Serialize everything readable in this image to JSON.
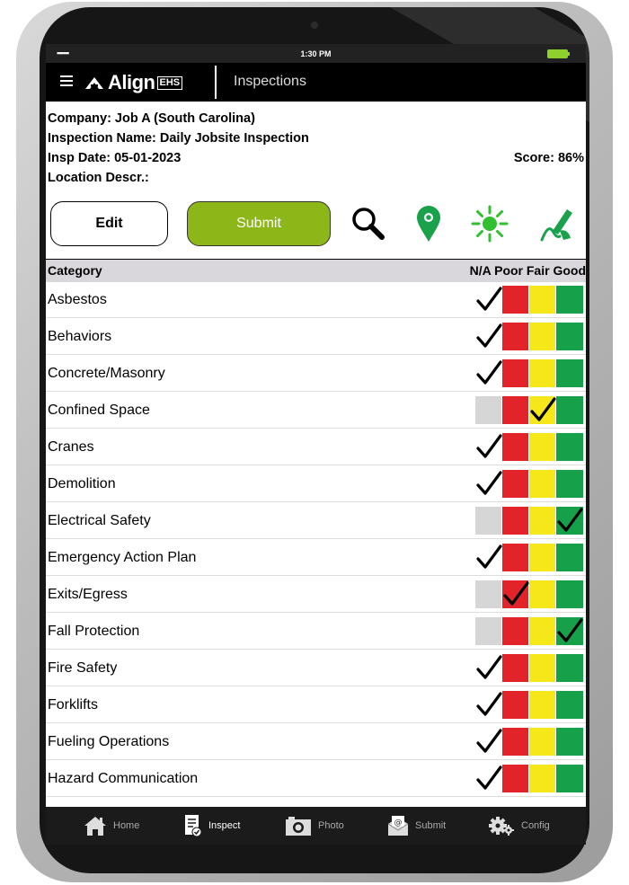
{
  "status_bar": {
    "signal": "▪▪▪▪▪▪",
    "time": "1:30 PM"
  },
  "app": {
    "brand": "Align",
    "brand_badge": "EHS",
    "section": "Inspections"
  },
  "info": {
    "company": "Company: Job A (South Carolina)",
    "inspection_name": "Inspection Name: Daily Jobsite Inspection",
    "insp_date": "Insp Date: 05-01-2023",
    "score": "Score: 86%",
    "location": "Location Descr.:"
  },
  "buttons": {
    "edit": "Edit",
    "submit": "Submit"
  },
  "toolbar_icons": [
    "search-icon",
    "map-pin-icon",
    "sun-icon",
    "signature-icon"
  ],
  "table": {
    "header_category": "Category",
    "header_cols": "N/A Poor Fair Good",
    "rows": [
      {
        "label": "Asbestos",
        "rating": "na"
      },
      {
        "label": "Behaviors",
        "rating": "na"
      },
      {
        "label": "Concrete/Masonry",
        "rating": "na"
      },
      {
        "label": "Confined Space",
        "rating": "fair"
      },
      {
        "label": "Cranes",
        "rating": "na"
      },
      {
        "label": "Demolition",
        "rating": "na"
      },
      {
        "label": "Electrical Safety",
        "rating": "good"
      },
      {
        "label": "Emergency Action Plan",
        "rating": "na"
      },
      {
        "label": "Exits/Egress",
        "rating": "poor"
      },
      {
        "label": "Fall Protection",
        "rating": "good"
      },
      {
        "label": "Fire Safety",
        "rating": "na"
      },
      {
        "label": "Forklifts",
        "rating": "na"
      },
      {
        "label": "Fueling Operations",
        "rating": "na"
      },
      {
        "label": "Hazard Communication",
        "rating": "na"
      }
    ]
  },
  "tabbar": {
    "home": "Home",
    "inspect": "Inspect",
    "photo": "Photo",
    "submit": "Submit",
    "config": "Config",
    "active": "inspect"
  },
  "colors": {
    "submit_green": "#8db719",
    "poor": "#e2242a",
    "fair": "#f5e71a",
    "good": "#17a04a",
    "pin_green": "#1aa14b",
    "sun_green": "#2fbf2f"
  }
}
